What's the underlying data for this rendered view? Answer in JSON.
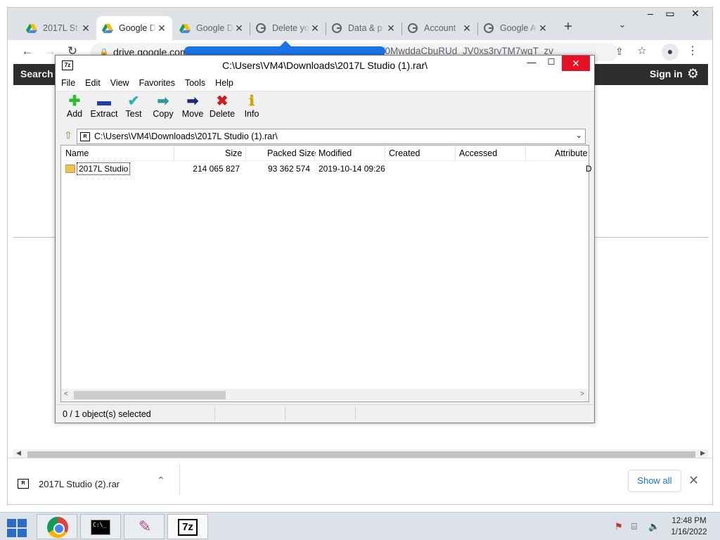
{
  "browser": {
    "tabs": [
      {
        "label": "2017L St",
        "icon": "google-drive-icon",
        "active": false
      },
      {
        "label": "Google D",
        "icon": "google-drive-icon",
        "active": true
      },
      {
        "label": "Google D",
        "icon": "google-drive-icon",
        "active": false
      },
      {
        "label": "Delete yo",
        "icon": "google-g-icon",
        "active": false
      },
      {
        "label": "Data & p",
        "icon": "google-g-icon",
        "active": false
      },
      {
        "label": "Account",
        "icon": "google-g-icon",
        "active": false
      },
      {
        "label": "Google A",
        "icon": "google-g-icon",
        "active": false
      }
    ],
    "new_tab": "+",
    "url_host": "drive.google.com",
    "url_tail": "uV0MwddaCbuRUd_JV0xs3rvTM7wqT_zv",
    "gbar": {
      "search": "Search",
      "signin": "Sign in"
    },
    "download": {
      "filename": "2017L Studio (2).rar",
      "show_all": "Show all"
    }
  },
  "sevenzip": {
    "title": "C:\\Users\\VM4\\Downloads\\2017L Studio (1).rar\\",
    "menu": [
      "File",
      "Edit",
      "View",
      "Favorites",
      "Tools",
      "Help"
    ],
    "tools": [
      {
        "label": "Add",
        "icon": "add-icon",
        "color": "#2bbf2b"
      },
      {
        "label": "Extract",
        "icon": "extract-icon",
        "color": "#1f3fa8"
      },
      {
        "label": "Test",
        "icon": "test-icon",
        "color": "#2ab5b5"
      },
      {
        "label": "Copy",
        "icon": "copy-icon",
        "color": "#2a9a9a"
      },
      {
        "label": "Move",
        "icon": "move-icon",
        "color": "#1a2a80"
      },
      {
        "label": "Delete",
        "icon": "delete-icon",
        "color": "#d11a1a"
      },
      {
        "label": "Info",
        "icon": "info-icon",
        "color": "#c9a800"
      }
    ],
    "path": "C:\\Users\\VM4\\Downloads\\2017L Studio (1).rar\\",
    "columns": [
      "Name",
      "Size",
      "Packed Size",
      "Modified",
      "Created",
      "Accessed",
      "Attribute"
    ],
    "rows": [
      {
        "name": "2017L Studio",
        "size": "214 065 827",
        "packed": "93 362 574",
        "modified": "2019-10-14 09:26",
        "created": "",
        "accessed": "",
        "attr": "D"
      }
    ],
    "status": "0 / 1 object(s) selected"
  },
  "taskbar": {
    "clock_time": "12:48 PM",
    "clock_date": "1/16/2022",
    "apps": [
      "chrome-icon",
      "cmd-icon",
      "paint-icon",
      "7zip-icon"
    ]
  }
}
